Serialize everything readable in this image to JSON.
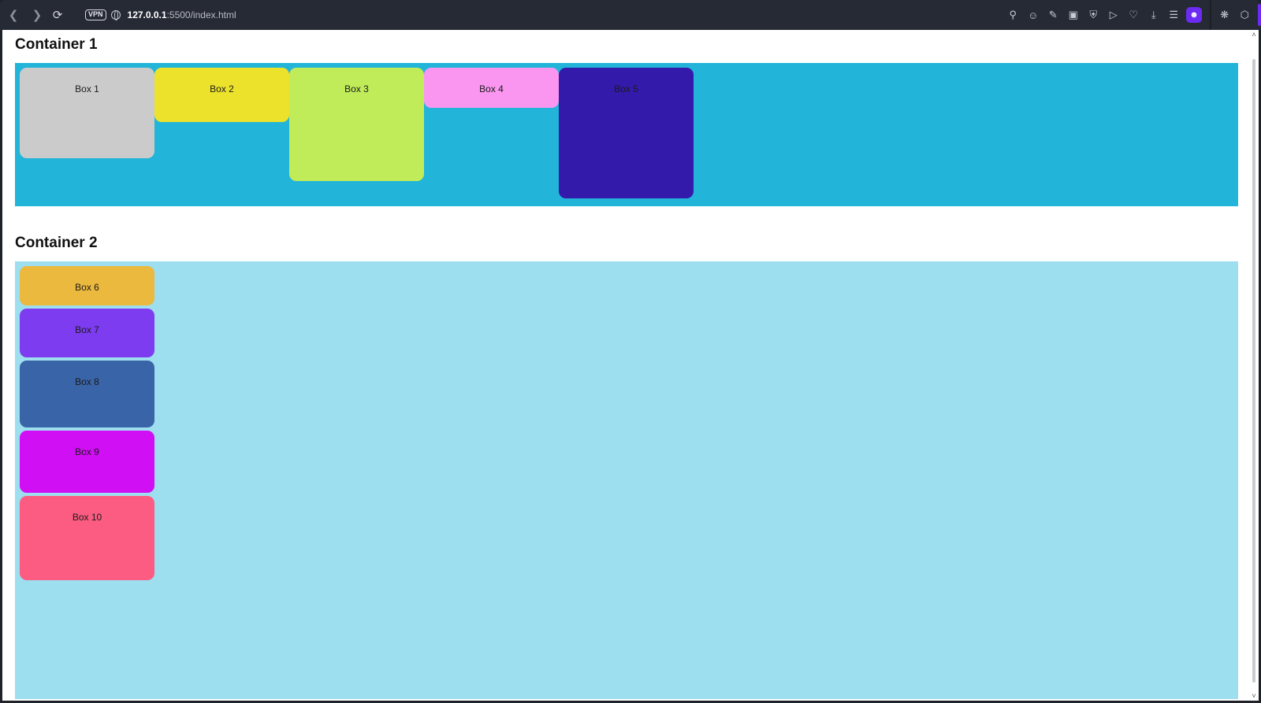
{
  "browser": {
    "url_host": "127.0.0.1",
    "url_path": ":5500/index.html",
    "vpn_label": "VPN"
  },
  "page": {
    "container1": {
      "title": "Container 1",
      "boxes": [
        {
          "label": "Box 1",
          "color": "#cbcbcb"
        },
        {
          "label": "Box 2",
          "color": "#ece22b"
        },
        {
          "label": "Box 3",
          "color": "#c0ec5a"
        },
        {
          "label": "Box 4",
          "color": "#fa96f0"
        },
        {
          "label": "Box 5",
          "color": "#341aab"
        }
      ]
    },
    "container2": {
      "title": "Container 2",
      "boxes": [
        {
          "label": "Box 6",
          "color": "#ecb93f"
        },
        {
          "label": "Box 7",
          "color": "#7d3cef"
        },
        {
          "label": "Box 8",
          "color": "#3a64a8"
        },
        {
          "label": "Box 9",
          "color": "#d10ff5"
        },
        {
          "label": "Box 10",
          "color": "#fc5c82"
        }
      ]
    }
  }
}
